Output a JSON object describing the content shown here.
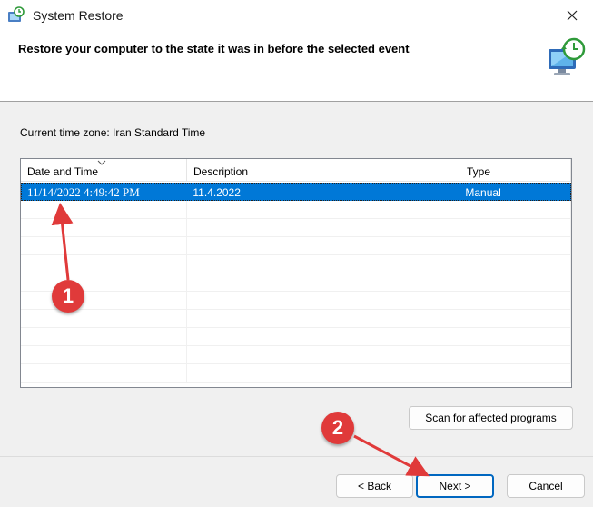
{
  "window": {
    "title": "System Restore",
    "close_icon": "close-icon"
  },
  "header": {
    "heading": "Restore your computer to the state it was in before the selected event"
  },
  "timezone": {
    "label": "Current time zone: Iran Standard Time"
  },
  "restore_points": {
    "columns": [
      "Date and Time",
      "Description",
      "Type"
    ],
    "rows": [
      {
        "date_time": "11/14/2022 4:49:42 PM",
        "description": "11.4.2022",
        "type": "Manual",
        "selected": true
      }
    ],
    "empty_rows": 10
  },
  "buttons": {
    "scan": "Scan for affected programs",
    "back": "< Back",
    "next": "Next >",
    "cancel": "Cancel"
  },
  "annotations": {
    "callout_1": "1",
    "callout_2": "2",
    "color": "#e03a3a"
  },
  "colors": {
    "selection": "#0078d7",
    "accent_border": "#0067c0"
  }
}
